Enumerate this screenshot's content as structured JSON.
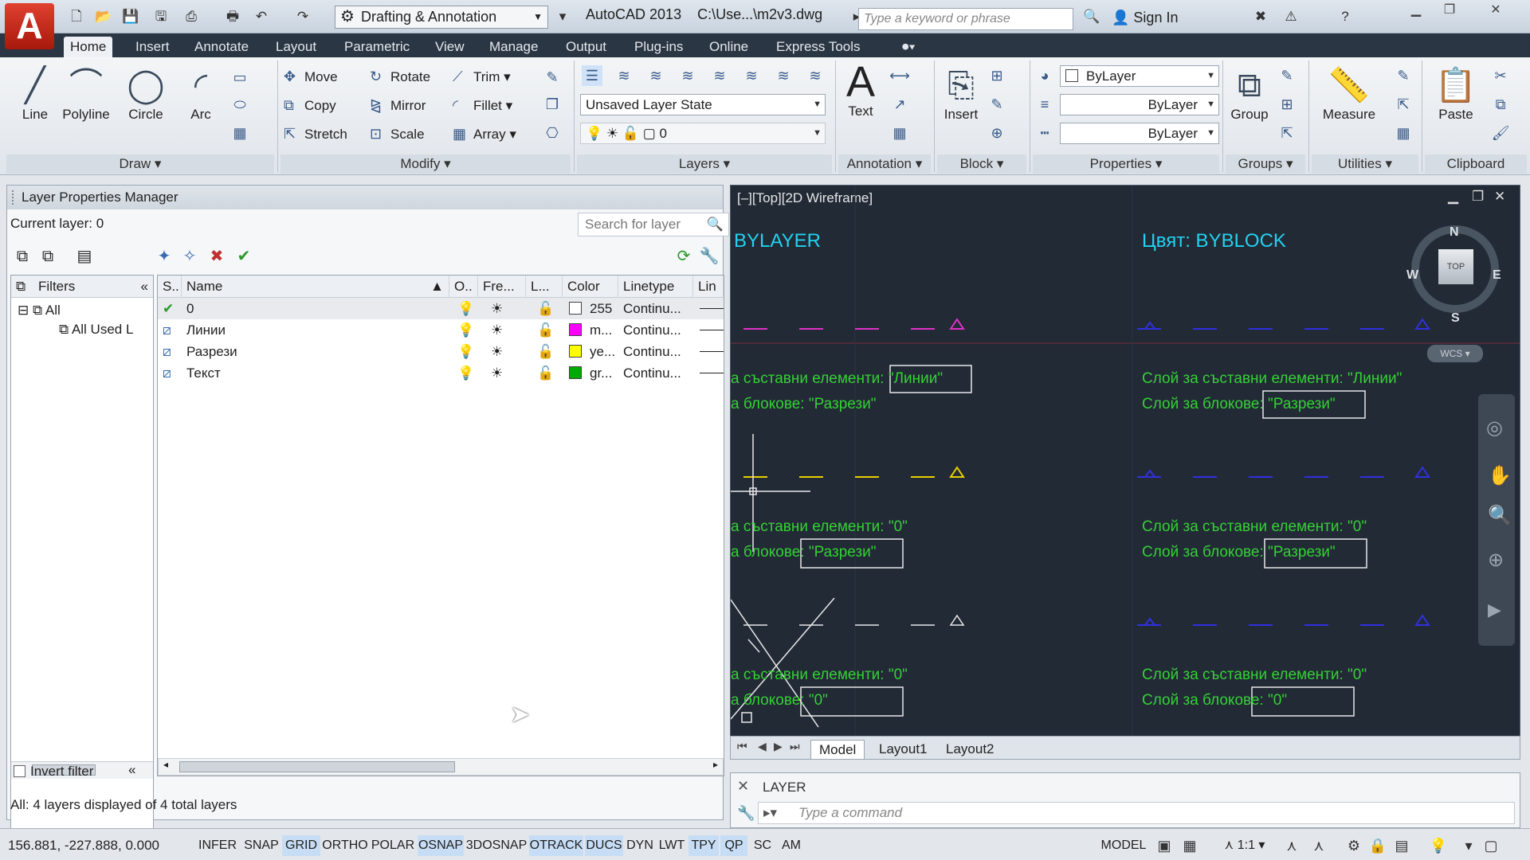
{
  "title_bar": {
    "workspace": "Drafting & Annotation",
    "app_title": "AutoCAD 2013",
    "file_path": "C:\\Use...\\m2v3.dwg",
    "search_placeholder": "Type a keyword or phrase",
    "sign_in": "Sign In",
    "quick_access": [
      "new-icon",
      "open-icon",
      "save-icon",
      "save-as-icon",
      "plot-icon",
      "print-icon",
      "undo-icon",
      "redo-icon"
    ]
  },
  "ribbon_tabs": [
    "Home",
    "Insert",
    "Annotate",
    "Layout",
    "Parametric",
    "View",
    "Manage",
    "Output",
    "Plug-ins",
    "Online",
    "Express Tools"
  ],
  "ribbon": {
    "draw": {
      "title": "Draw",
      "line": "Line",
      "polyline": "Polyline",
      "circle": "Circle",
      "arc": "Arc"
    },
    "modify": {
      "title": "Modify",
      "move": "Move",
      "rotate": "Rotate",
      "trim": "Trim",
      "copy": "Copy",
      "mirror": "Mirror",
      "fillet": "Fillet",
      "stretch": "Stretch",
      "scale": "Scale",
      "array": "Array"
    },
    "layers": {
      "title": "Layers",
      "layer_state": "Unsaved Layer State",
      "current_layer": "0"
    },
    "annotation": {
      "title": "Annotation",
      "text": "Text"
    },
    "block": {
      "title": "Block",
      "insert": "Insert"
    },
    "properties": {
      "title": "Properties",
      "color": "ByLayer",
      "lineweight": "ByLayer",
      "linetype": "ByLayer"
    },
    "groups": {
      "title": "Groups",
      "group": "Group"
    },
    "utilities": {
      "title": "Utilities",
      "measure": "Measure"
    },
    "clipboard": {
      "title": "Clipboard",
      "paste": "Paste"
    }
  },
  "layer_manager": {
    "title": "Layer Properties Manager",
    "current_layer": "Current layer: 0",
    "search_placeholder": "Search for layer",
    "filters": {
      "header": "Filters",
      "all": "All",
      "all_used": "All Used L"
    },
    "columns": {
      "status": "S..",
      "name": "Name",
      "on": "O..",
      "freeze": "Fre...",
      "lock": "L...",
      "color": "Color",
      "linetype": "Linetype",
      "lineweight": "Lin"
    },
    "layers": [
      {
        "status": "current",
        "name": "0",
        "color_name": "255",
        "color_hex": "#ffffff",
        "linetype": "Continu..."
      },
      {
        "status": "layer",
        "name": "Линии",
        "color_name": "m...",
        "color_hex": "#ff00ff",
        "linetype": "Continu..."
      },
      {
        "status": "layer",
        "name": "Разрези",
        "color_name": "ye...",
        "color_hex": "#ffff00",
        "linetype": "Continu..."
      },
      {
        "status": "layer",
        "name": "Текст",
        "color_name": "gr...",
        "color_hex": "#00aa00",
        "linetype": "Continu..."
      }
    ],
    "invert_filter": "Invert filter",
    "status_text": "All: 4 layers displayed of 4 total layers"
  },
  "viewport": {
    "label": "[–][Top][2D Wireframe]",
    "heading_left": "BYLAYER",
    "heading_right": "Цвят: BYBLOCK",
    "left_texts": [
      "а съставни елементи: \"Линии\"",
      "а блокове: \"Разрези\"",
      "а съставни елементи: \"0\"",
      "а блокове: \"Разрези\"",
      "а съставни елементи: \"0\"",
      "а блокове: \"0\""
    ],
    "right_texts": [
      "Слой за съставни елементи: \"Линии\"",
      "Слой за блокове: \"Разрези\"",
      "Слой за съставни елементи: \"0\"",
      "Слой за блокове: \"Разрези\"",
      "Слой за съставни елементи: \"0\"",
      "Слой за блокове: \"0\""
    ],
    "viewcube": {
      "n": "N",
      "s": "S",
      "e": "E",
      "w": "W",
      "top": "TOP",
      "ucs": "WCS"
    },
    "colors": {
      "green": "#35d035",
      "cyan": "#22d2ef",
      "magenta": "#e030c8",
      "yellow": "#e8d000",
      "blue": "#3030e0",
      "background": "#222a36"
    }
  },
  "layout_tabs": [
    "Model",
    "Layout1",
    "Layout2"
  ],
  "command": {
    "history": "LAYER",
    "placeholder": "Type a command"
  },
  "status_bar": {
    "coords": "156.881, -227.888, 0.000",
    "toggles": [
      {
        "label": "INFER",
        "on": false
      },
      {
        "label": "SNAP",
        "on": false
      },
      {
        "label": "GRID",
        "on": true
      },
      {
        "label": "ORTHO",
        "on": false
      },
      {
        "label": "POLAR",
        "on": false
      },
      {
        "label": "OSNAP",
        "on": true
      },
      {
        "label": "3DOSNAP",
        "on": false
      },
      {
        "label": "OTRACK",
        "on": true
      },
      {
        "label": "DUCS",
        "on": true
      },
      {
        "label": "DYN",
        "on": false
      },
      {
        "label": "LWT",
        "on": false
      },
      {
        "label": "TPY",
        "on": true
      },
      {
        "label": "QP",
        "on": true
      },
      {
        "label": "SC",
        "on": false
      },
      {
        "label": "AM",
        "on": false
      }
    ],
    "model": "MODEL",
    "scale": "1:1"
  }
}
